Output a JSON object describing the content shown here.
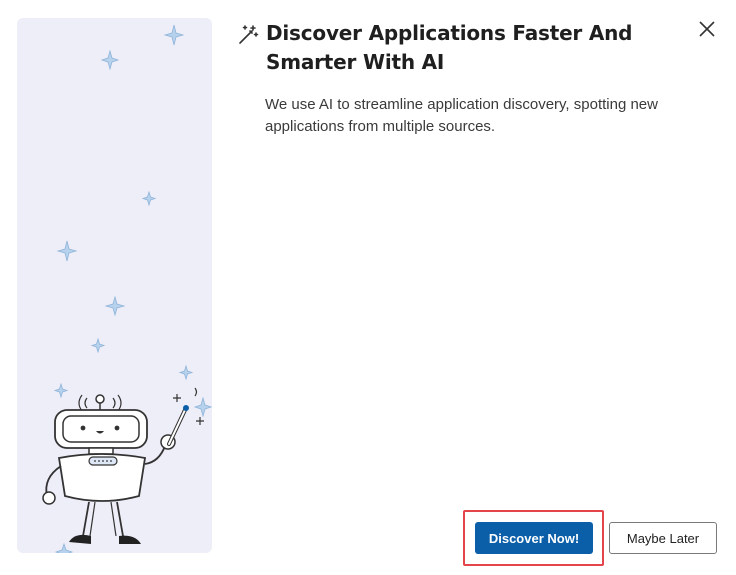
{
  "dialog": {
    "title": "Discover Applications Faster And Smarter With AI",
    "description": "We use AI to streamline application discovery, spotting new applications from multiple sources.",
    "icons": {
      "title_icon": "magic-wand-icon",
      "close_icon": "close-icon"
    }
  },
  "actions": {
    "primary_label": "Discover Now!",
    "secondary_label": "Maybe Later"
  },
  "colors": {
    "primary_button": "#0a5fa8",
    "highlight_border": "#e4454a",
    "illustration_bg": "#eeeef9",
    "sparkle": "#b7d2ec"
  }
}
